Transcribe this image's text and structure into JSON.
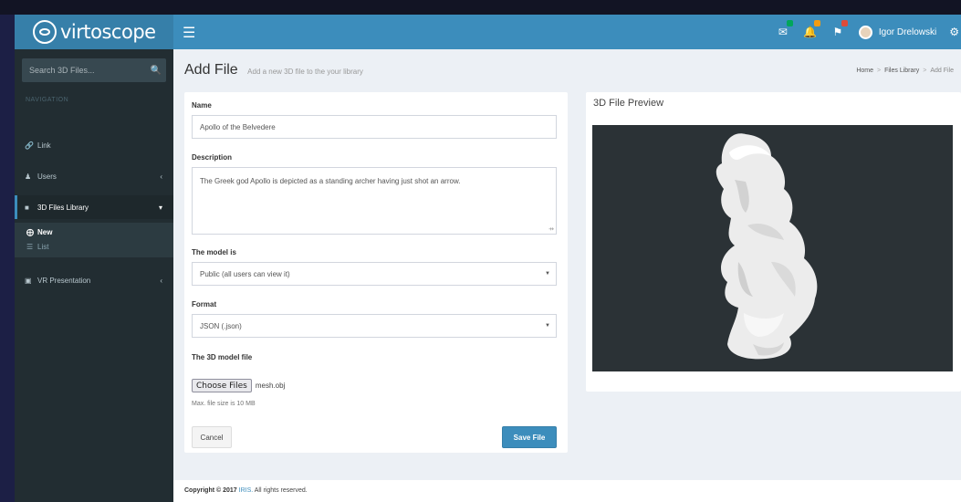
{
  "app": {
    "brand": "virtoscope"
  },
  "header": {
    "toggle_icon": "hamburger-icon",
    "nav_icons": [
      {
        "name": "messages-icon",
        "badge": "#00a65a"
      },
      {
        "name": "notifications-icon",
        "badge": "#f39c12"
      },
      {
        "name": "flag-icon",
        "badge": "#dd4b39"
      }
    ],
    "user_name": "Igor Drelowski",
    "accent": "#3c8dbc"
  },
  "sidebar": {
    "search_placeholder": "Search 3D Files...",
    "nav_header": "NAVIGATION",
    "items": [
      {
        "label": "Link",
        "icon": "link-icon"
      },
      {
        "label": "Users",
        "icon": "user-icon"
      },
      {
        "label": "3D Files Library",
        "icon": "file-icon"
      },
      {
        "label": "VR Presentation",
        "icon": "vr-icon"
      }
    ],
    "submenu": [
      {
        "label": "New",
        "icon": "plus-circle-icon"
      },
      {
        "label": "List",
        "icon": "list-icon"
      }
    ]
  },
  "page": {
    "title": "Add File",
    "subtitle": "Add a new 3D file to the your library",
    "breadcrumb": [
      "Home",
      "Files Library",
      "Add File"
    ]
  },
  "form": {
    "name_label": "Name",
    "name_value": "Apollo of the Belvedere",
    "description_label": "Description",
    "description_value": "The Greek god Apollo is depicted as a standing archer having just shot an arrow.",
    "model_label": "The model is",
    "model_value": "Public (all users can view it)",
    "format_label": "Format",
    "format_value": "JSON (.json)",
    "file_label": "The 3D model file",
    "choose_button": "Choose Files",
    "file_name": "mesh.obj",
    "help_text": "Max. file size is 10 MB",
    "cancel": "Cancel",
    "save": "Save File"
  },
  "preview": {
    "title": "3D File Preview"
  },
  "footer": {
    "copyright": "Copyright © 2017",
    "company": "IRIS.",
    "rights": "All rights reserved."
  }
}
